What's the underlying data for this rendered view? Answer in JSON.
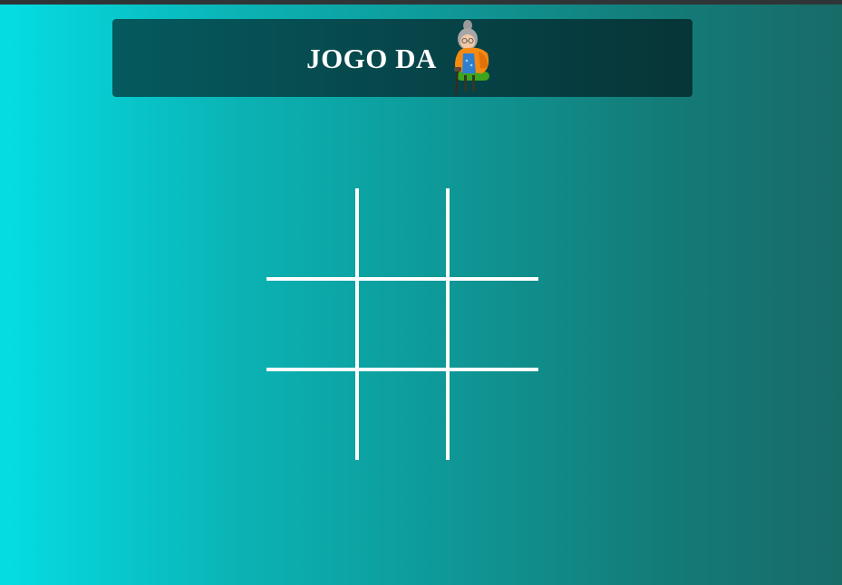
{
  "header": {
    "title": "JOGO DA",
    "mascot_icon": "grandma-icon"
  },
  "board": {
    "cells": [
      "",
      "",
      "",
      "",
      "",
      "",
      "",
      "",
      ""
    ]
  },
  "colors": {
    "background_left": "#04dde4",
    "background_right": "#186b68",
    "header_bg": "#064448",
    "grid_lines": "#ffffff",
    "title_text": "#ffffff"
  }
}
